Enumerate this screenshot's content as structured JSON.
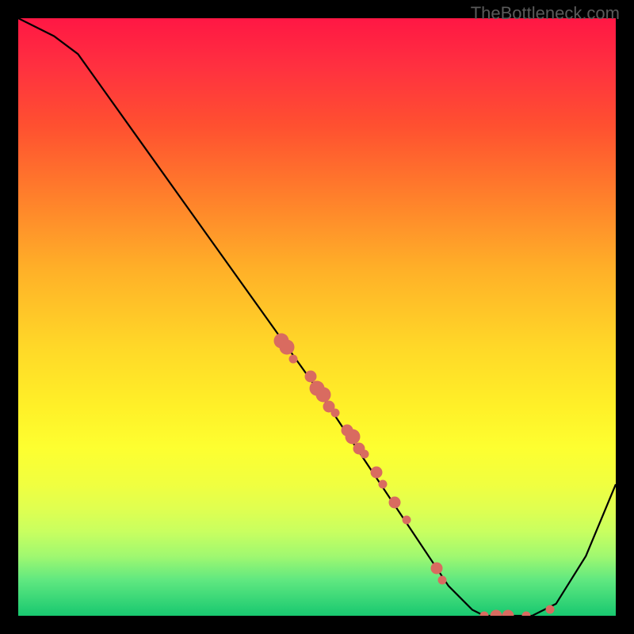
{
  "watermark": "TheBottleneck.com",
  "chart_data": {
    "type": "line",
    "title": "",
    "xlabel": "",
    "ylabel": "",
    "xlim": [
      0,
      100
    ],
    "ylim": [
      0,
      100
    ],
    "curve": [
      {
        "x": 0,
        "y": 100
      },
      {
        "x": 6,
        "y": 97
      },
      {
        "x": 10,
        "y": 94
      },
      {
        "x": 20,
        "y": 80
      },
      {
        "x": 30,
        "y": 66
      },
      {
        "x": 40,
        "y": 52
      },
      {
        "x": 50,
        "y": 38
      },
      {
        "x": 58,
        "y": 26
      },
      {
        "x": 66,
        "y": 14
      },
      {
        "x": 72,
        "y": 5
      },
      {
        "x": 76,
        "y": 1
      },
      {
        "x": 78,
        "y": 0
      },
      {
        "x": 86,
        "y": 0
      },
      {
        "x": 90,
        "y": 2
      },
      {
        "x": 95,
        "y": 10
      },
      {
        "x": 100,
        "y": 22
      }
    ],
    "points": [
      {
        "x": 44,
        "y": 46,
        "size": "large"
      },
      {
        "x": 45,
        "y": 45,
        "size": "large"
      },
      {
        "x": 46,
        "y": 43,
        "size": "small"
      },
      {
        "x": 49,
        "y": 40,
        "size": "medium"
      },
      {
        "x": 50,
        "y": 38,
        "size": "large"
      },
      {
        "x": 51,
        "y": 37,
        "size": "large"
      },
      {
        "x": 52,
        "y": 35,
        "size": "medium"
      },
      {
        "x": 53,
        "y": 34,
        "size": "small"
      },
      {
        "x": 55,
        "y": 31,
        "size": "medium"
      },
      {
        "x": 56,
        "y": 30,
        "size": "large"
      },
      {
        "x": 57,
        "y": 28,
        "size": "medium"
      },
      {
        "x": 58,
        "y": 27,
        "size": "small"
      },
      {
        "x": 60,
        "y": 24,
        "size": "medium"
      },
      {
        "x": 61,
        "y": 22,
        "size": "small"
      },
      {
        "x": 63,
        "y": 19,
        "size": "medium"
      },
      {
        "x": 65,
        "y": 16,
        "size": "small"
      },
      {
        "x": 70,
        "y": 8,
        "size": "medium"
      },
      {
        "x": 71,
        "y": 6,
        "size": "small"
      },
      {
        "x": 78,
        "y": 0,
        "size": "small"
      },
      {
        "x": 80,
        "y": 0,
        "size": "medium"
      },
      {
        "x": 82,
        "y": 0,
        "size": "medium"
      },
      {
        "x": 85,
        "y": 0,
        "size": "small"
      },
      {
        "x": 89,
        "y": 1,
        "size": "small"
      }
    ]
  },
  "sizes": {
    "small": 11,
    "medium": 15,
    "large": 19
  }
}
